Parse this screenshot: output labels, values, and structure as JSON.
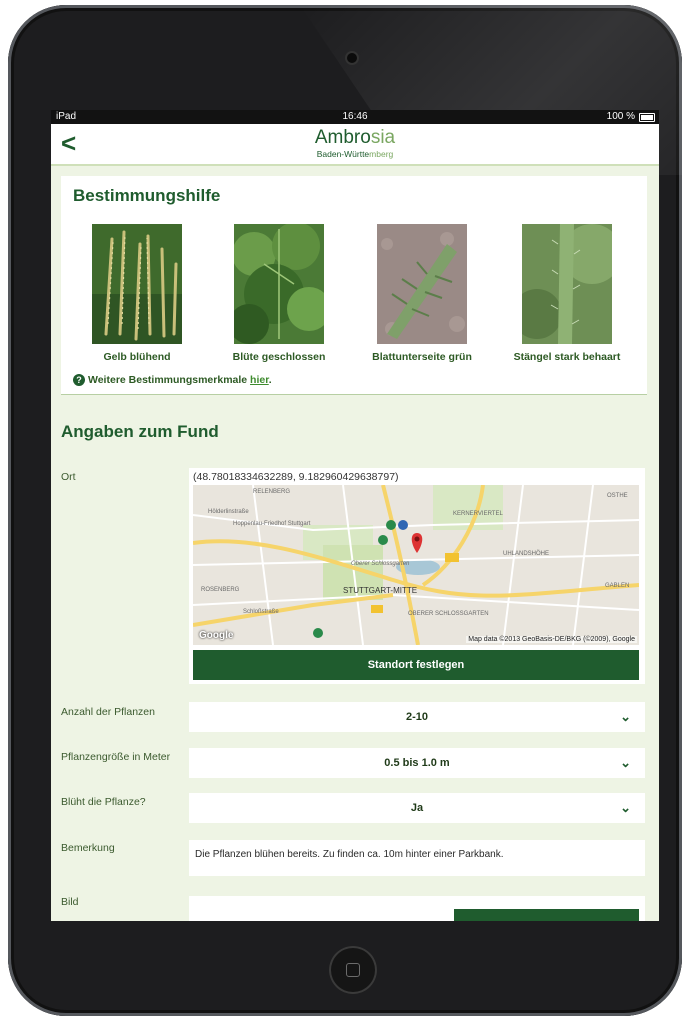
{
  "status_bar": {
    "carrier": "iPad",
    "time": "16:46",
    "battery": "100 %"
  },
  "nav": {
    "back_label": "<",
    "title_dark": "Ambro",
    "title_light": "sia",
    "subtitle_dark": "Baden-Württe",
    "subtitle_light": "mberg"
  },
  "identification": {
    "heading": "Bestimmungshilfe",
    "items": [
      {
        "label": "Gelb blühend"
      },
      {
        "label": "Blüte geschlossen"
      },
      {
        "label": "Blattunterseite grün"
      },
      {
        "label": "Stängel stark behaart"
      }
    ],
    "more_text": "Weitere Bestimmungsmerkmale ",
    "more_link": "hier",
    "more_suffix": "."
  },
  "report": {
    "heading": "Angaben zum Fund",
    "location_label": "Ort",
    "coordinates": "(48.78018334632289, 9.182960429638797)",
    "map_attribution": "Map data ©2013 GeoBasis-DE/BKG (©2009), Google",
    "google_logo": "Google",
    "map_labels": [
      "RELENBERG",
      "Hölderlinstraße",
      "Hoppenlau-Friedhof Stuttgart",
      "KERNERVIERTEL",
      "UHLANDSHÖHE",
      "Oberer Schlossgarten",
      "STUTTGART-MITTE",
      "ROSENBERG",
      "Schloßstraße",
      "OBERER SCHLOSSGARTEN",
      "GABLEN",
      "OSTHE"
    ],
    "set_location_button": "Standort festlegen",
    "plants_count_label": "Anzahl der Pflanzen",
    "plants_count_value": "2-10",
    "plant_size_label": "Pflanzengröße in Meter",
    "plant_size_value": "0.5 bis 1.0 m",
    "blooming_label": "Blüht die Pflanze?",
    "blooming_value": "Ja",
    "remark_label": "Bemerkung",
    "remark_value": "Die Pflanzen blühen bereits. Zu finden ca. 10m hinter einer Parkbank.",
    "image_label": "Bild"
  },
  "colors": {
    "brand_green": "#1f5c2e",
    "background": "#eef4e4",
    "accent_light": "#7aa761"
  }
}
